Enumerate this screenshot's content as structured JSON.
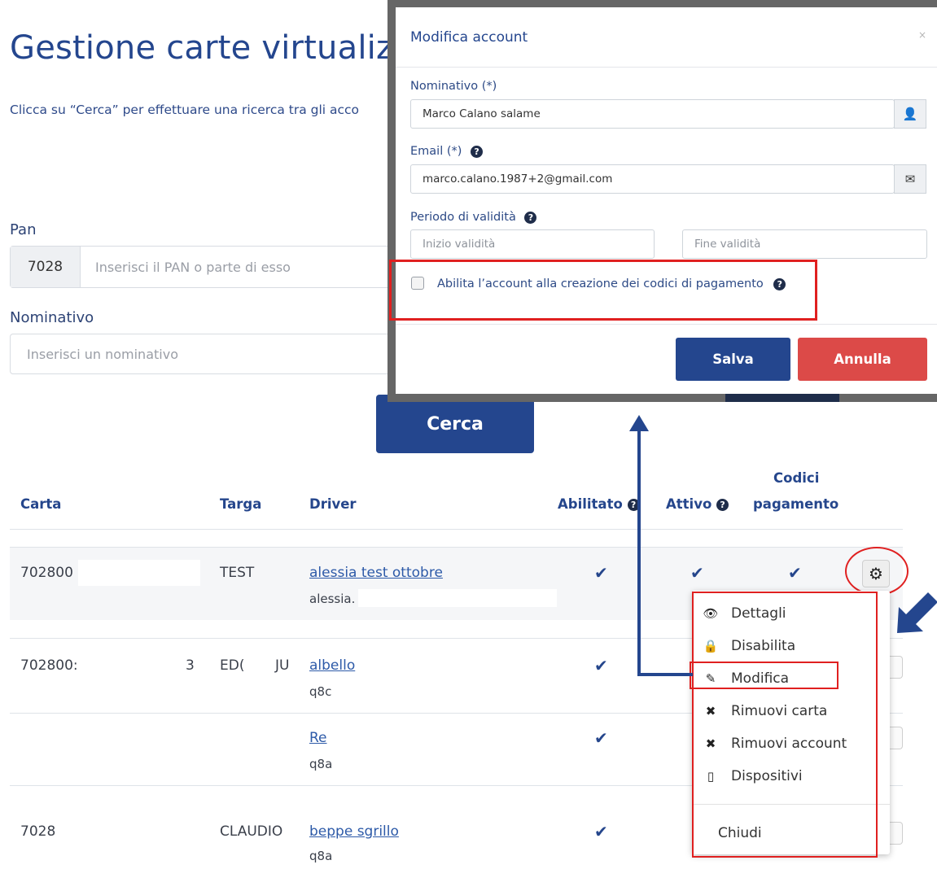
{
  "page": {
    "title": "Gestione carte virtualizz",
    "intro": "Clicca su “Cerca” per effettuare una ricerca tra gli acco",
    "pan_label": "Pan",
    "pan_prefix": "7028",
    "pan_placeholder": "Inserisci il PAN o parte di esso",
    "nominativo_label": "Nominativo",
    "nominativo_placeholder": "Inserisci un nominativo",
    "cerca_label": "Cerca"
  },
  "table": {
    "headers": {
      "carta": "Carta",
      "targa": "Targa",
      "driver": "Driver",
      "abilitato": "Abilitato",
      "attivo": "Attivo",
      "codici_1": "Codici",
      "codici_2": "pagamento"
    },
    "rows": [
      {
        "carta": "702800",
        "targa": "TEST",
        "driver": "alessia test ottobre",
        "sub": "alessia."
      },
      {
        "carta": "702800:",
        "carta_tail": "3",
        "targa": "ED(",
        "targa_tail": "JU",
        "driver": "albello",
        "sub": "q8c"
      },
      {
        "carta": "",
        "targa": "",
        "driver": "Re",
        "sub": "q8a"
      },
      {
        "carta": "7028",
        "targa": "CLAUDIO",
        "driver": "beppe sgrillo",
        "sub": "q8a"
      }
    ],
    "check_glyph": "✔",
    "help_glyph": "?"
  },
  "menu": {
    "items": [
      {
        "label": "Dettagli",
        "icon": "eye-icon",
        "glyph": "👁"
      },
      {
        "label": "Disabilita",
        "icon": "lock-icon",
        "glyph": "🔒"
      },
      {
        "label": "Modifica",
        "icon": "edit-icon",
        "glyph": "✎"
      },
      {
        "label": "Rimuovi carta",
        "icon": "times-icon",
        "glyph": "✖"
      },
      {
        "label": "Rimuovi account",
        "icon": "times-icon",
        "glyph": "✖"
      },
      {
        "label": "Dispositivi",
        "icon": "mobile-icon",
        "glyph": "▯"
      }
    ],
    "close_label": "Chiudi",
    "gear_glyph": "⚙"
  },
  "modal": {
    "title": "Modifica account",
    "close_glyph": "×",
    "nominativo_label": "Nominativo (*)",
    "nominativo_value": "Marco Calano salame",
    "email_label": "Email (*)",
    "email_value": "marco.calano.1987+2@gmail.com",
    "periodo_label": "Periodo di validità",
    "inizio_placeholder": "Inizio validità",
    "fine_placeholder": "Fine validità",
    "abilita_label": "Abilita l’account alla creazione dei codici di pagamento",
    "salva_label": "Salva",
    "annulla_label": "Annulla",
    "user_glyph": "👤",
    "envelope_glyph": "✉"
  },
  "colors": {
    "primary": "#24468e",
    "danger": "#dc4a48",
    "highlight": "#e02020"
  }
}
